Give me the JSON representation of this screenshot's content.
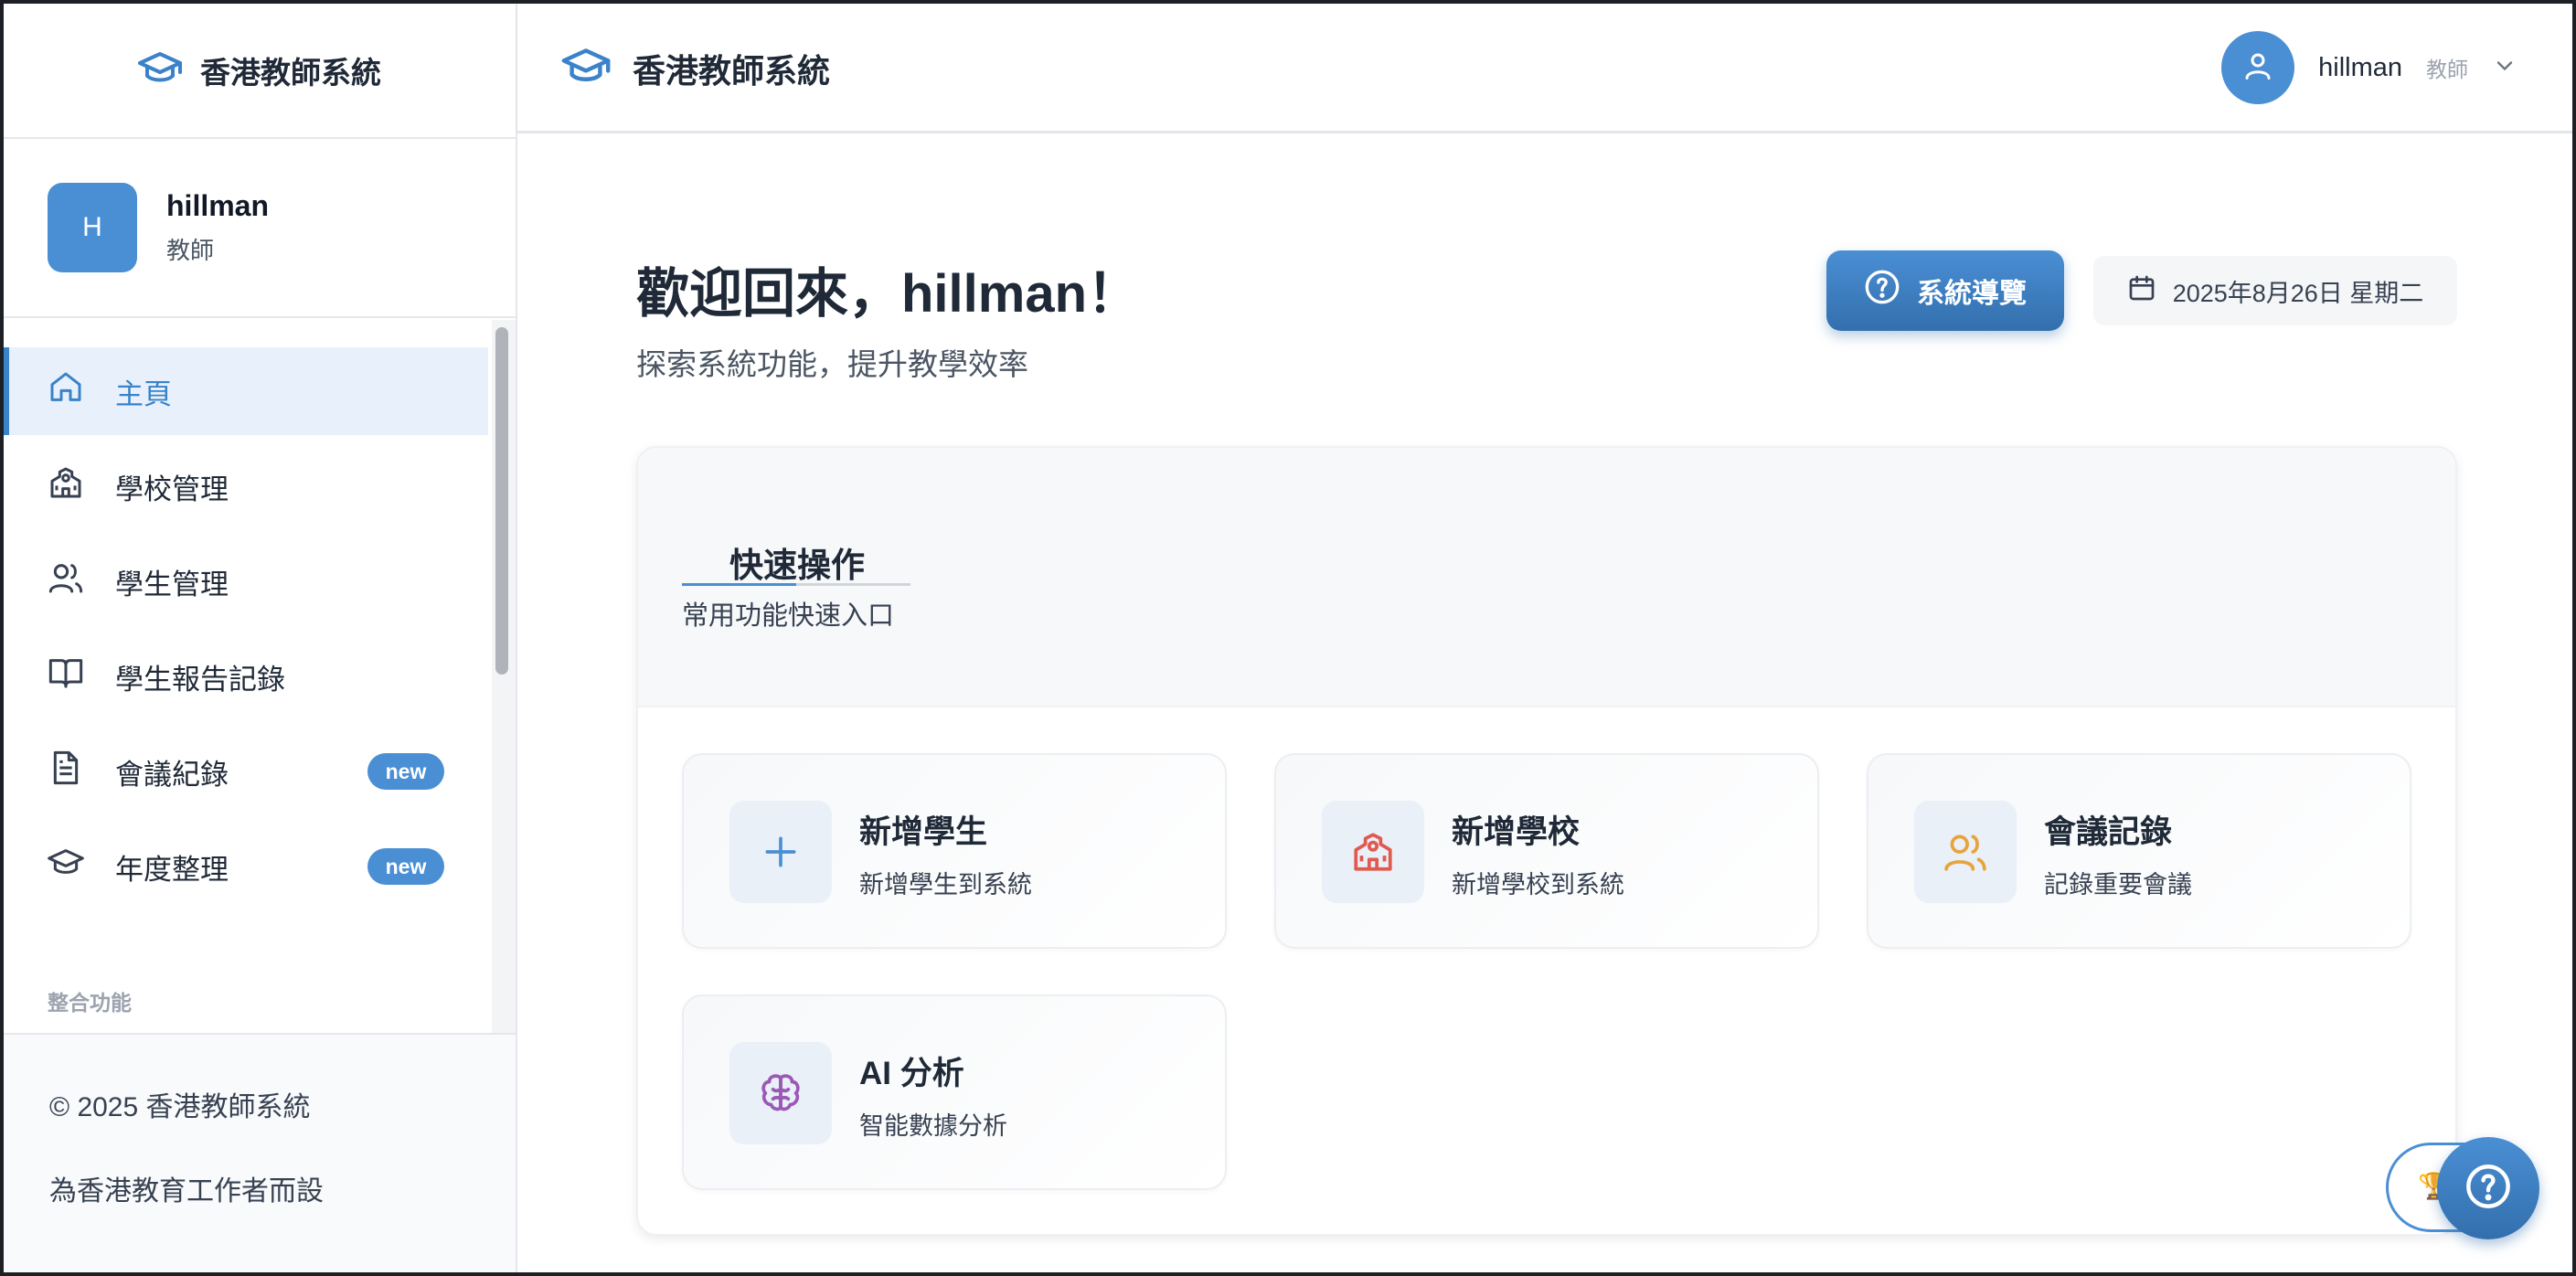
{
  "app": {
    "name": "香港教師系統"
  },
  "user": {
    "initial": "H",
    "name": "hillman",
    "role": "教師"
  },
  "sidebar": {
    "items": [
      {
        "label": "主頁",
        "icon": "home-icon",
        "active": true
      },
      {
        "label": "學校管理",
        "icon": "school-icon"
      },
      {
        "label": "學生管理",
        "icon": "users-icon"
      },
      {
        "label": "學生報告記錄",
        "icon": "book-icon"
      },
      {
        "label": "會議紀錄",
        "icon": "document-icon",
        "badge": "new"
      },
      {
        "label": "年度整理",
        "icon": "graduation-cap-icon",
        "badge": "new"
      }
    ],
    "section_label": "整合功能",
    "footer": {
      "copyright": "© 2025 香港教師系統",
      "tagline": "為香港教育工作者而設"
    }
  },
  "main": {
    "welcome": "歡迎回來，hillman！",
    "subtitle": "探索系統功能，提升教學效率",
    "tour_button": "系統導覽",
    "date": "2025年8月26日 星期二",
    "quick_actions": {
      "title": "快速操作",
      "subtitle": "常用功能快速入口",
      "cards": [
        {
          "title": "新增學生",
          "desc": "新增學生到系統",
          "icon": "plus-icon",
          "color": "#4a8fd4"
        },
        {
          "title": "新增學校",
          "desc": "新增學校到系統",
          "icon": "school-icon",
          "color": "#e05a4f"
        },
        {
          "title": "會議記錄",
          "desc": "記錄重要會議",
          "icon": "users-icon",
          "color": "#e8a33d"
        },
        {
          "title": "AI 分析",
          "desc": "智能數據分析",
          "icon": "brain-icon",
          "color": "#9b59b6"
        }
      ]
    }
  },
  "colors": {
    "accent": "#4a8fd4",
    "accent_dark": "#336fad"
  }
}
